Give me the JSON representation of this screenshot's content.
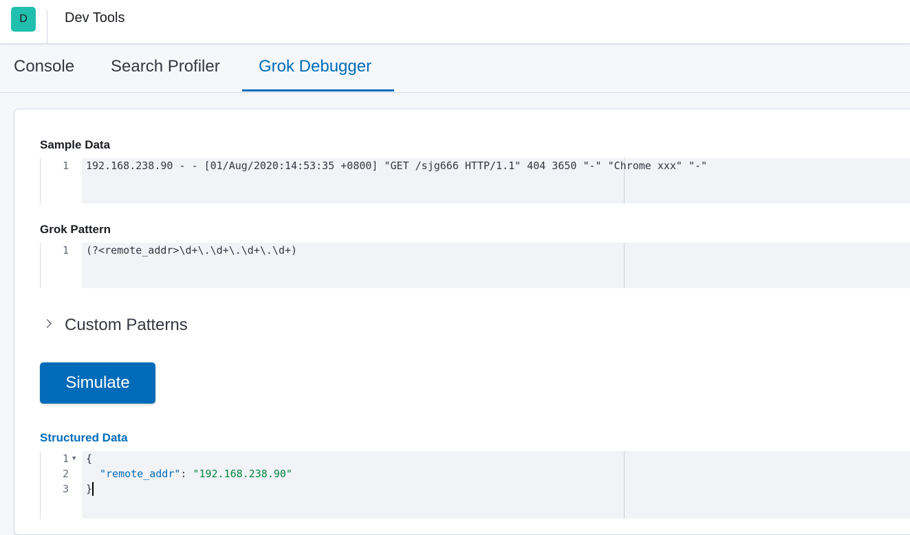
{
  "header": {
    "space_initial": "D",
    "title": "Dev Tools"
  },
  "tabs": [
    {
      "label": "Console",
      "active": false
    },
    {
      "label": "Search Profiler",
      "active": false
    },
    {
      "label": "Grok Debugger",
      "active": true
    }
  ],
  "sample_data": {
    "label": "Sample Data",
    "lines": [
      {
        "num": "1",
        "text": "192.168.238.90 - - [01/Aug/2020:14:53:35 +0800] \"GET /sjg666 HTTP/1.1\" 404 3650 \"-\" \"Chrome xxx\" \"-\""
      }
    ]
  },
  "grok_pattern": {
    "label": "Grok Pattern",
    "lines": [
      {
        "num": "1",
        "text": "(?<remote_addr>\\d+\\.\\d+\\.\\d+\\.\\d+)"
      }
    ]
  },
  "custom_patterns": {
    "label": "Custom Patterns",
    "icon": "chevron-right-icon",
    "expanded": false
  },
  "simulate_button": {
    "label": "Simulate"
  },
  "structured_data": {
    "label": "Structured Data",
    "line_numbers": [
      "1",
      "2",
      "3"
    ],
    "open_brace": "{",
    "close_brace": "}",
    "key": "\"remote_addr\"",
    "colon": ": ",
    "value": "\"192.168.238.90\""
  },
  "colors": {
    "accent": "#006bb8",
    "space_avatar": "#20bfae",
    "json_string": "#00853e"
  }
}
